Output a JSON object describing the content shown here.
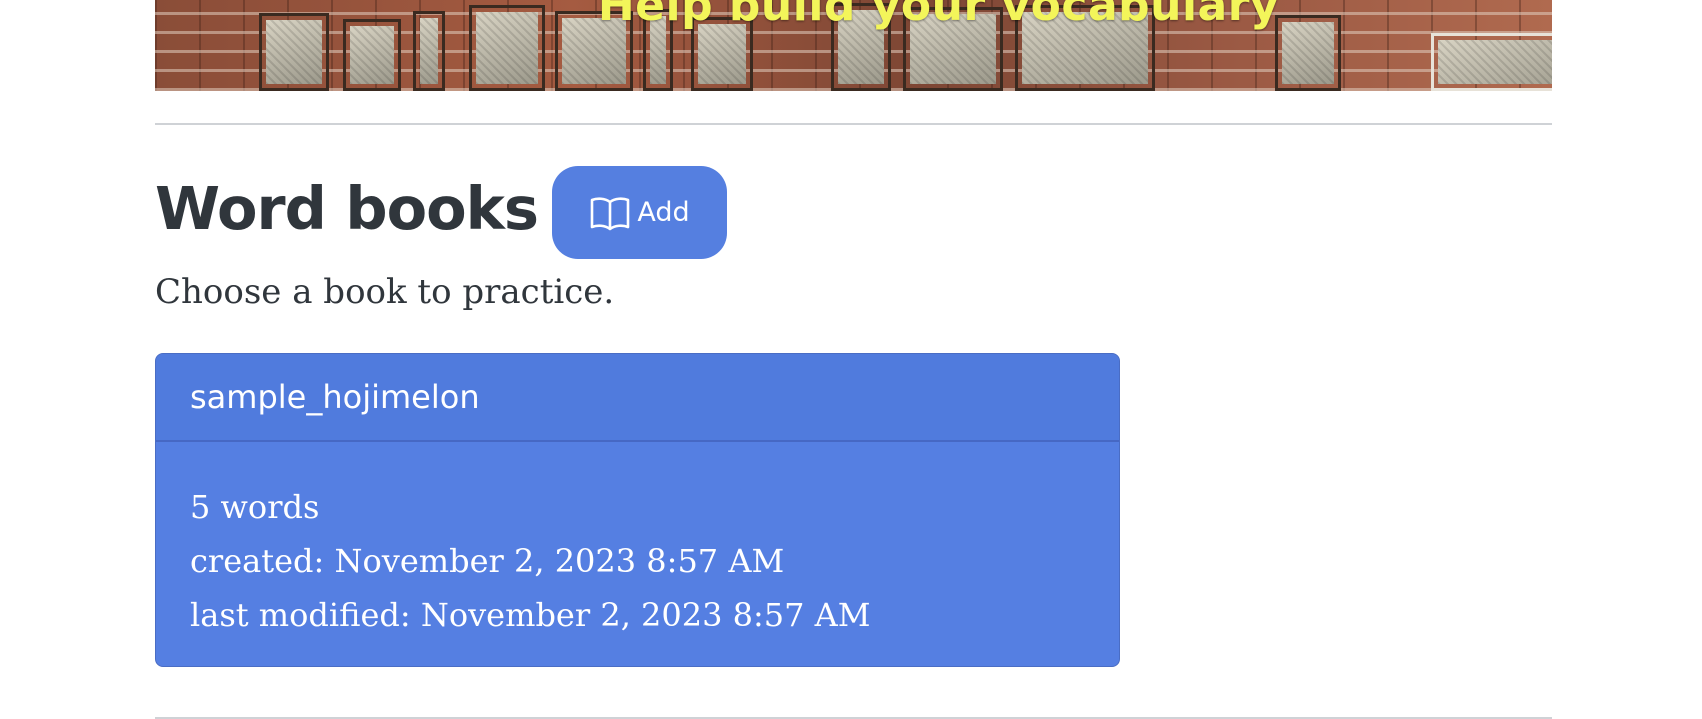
{
  "hero": {
    "title": "Help build your vocabulary"
  },
  "header": {
    "title": "Word books",
    "add_button_label": "Add",
    "add_icon": "book-open-icon"
  },
  "subtitle": "Choose a book to practice.",
  "books": [
    {
      "name": "sample_hojimelon",
      "word_count": "5 words",
      "created": "created: November 2, 2023 8:57 AM",
      "modified": "last modified: November 2, 2023 8:57 AM"
    }
  ],
  "colors": {
    "accent": "#557fe0",
    "hero_text": "#f3f55a",
    "heading": "#30363c",
    "rule": "#cfd2d6"
  }
}
